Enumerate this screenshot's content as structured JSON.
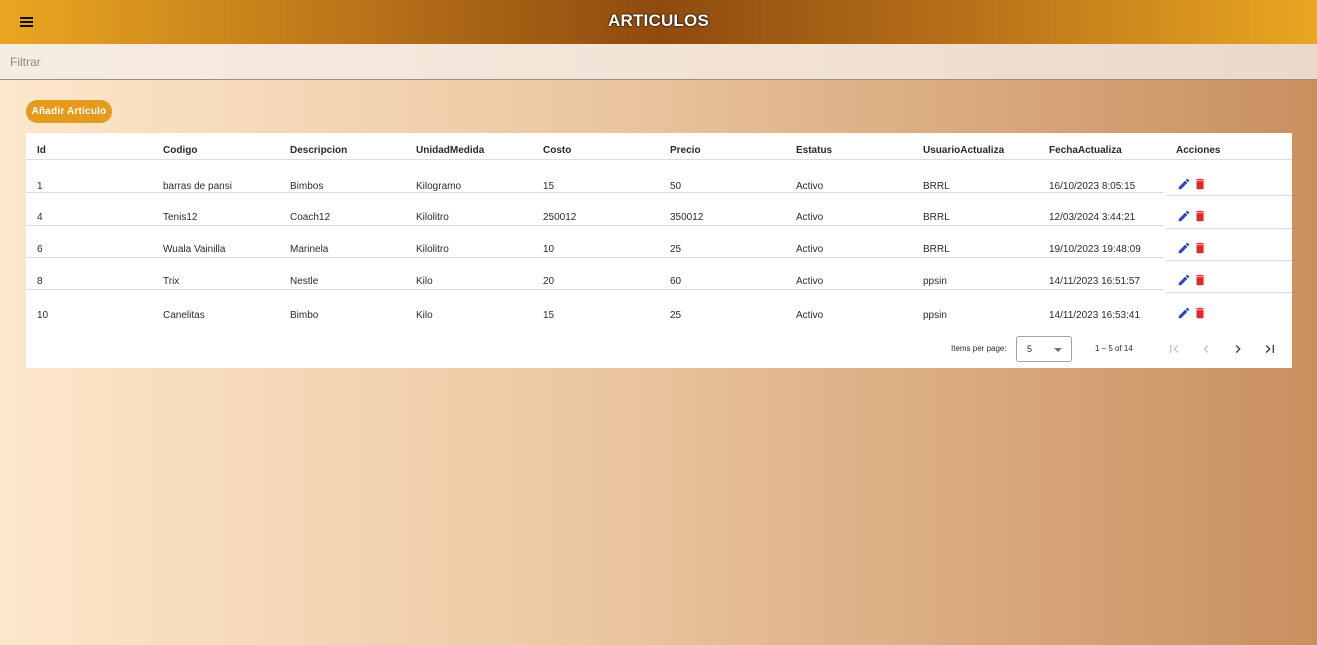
{
  "header": {
    "title": "ARTICULOS",
    "menu_icon": "hamburger-menu-icon",
    "colors": {
      "bar_edge": "#e9a721",
      "bar_center": "#8f4b0f",
      "title_text": "#ffffff"
    }
  },
  "filter": {
    "placeholder": "Filtrar",
    "value": ""
  },
  "actions": {
    "add_label": "Añadir Articulo",
    "add_color": "#e49a1a"
  },
  "table": {
    "columns": [
      "Id",
      "Codigo",
      "Descripcion",
      "UnidadMedida",
      "Costo",
      "Precio",
      "Estatus",
      "UsuarioActualiza",
      "FechaActualiza",
      "Acciones"
    ],
    "rows": [
      {
        "id": "1",
        "codigo": "barras de pansi",
        "descripcion": "Bimbos",
        "unidad": "Kilogramo",
        "costo": "15",
        "precio": "50",
        "estatus": "Activo",
        "usuario": "BRRL",
        "fecha": "16/10/2023 8:05:15"
      },
      {
        "id": "4",
        "codigo": "Tenis12",
        "descripcion": "Coach12",
        "unidad": "Kilolitro",
        "costo": "250012",
        "precio": "350012",
        "estatus": "Activo",
        "usuario": "BRRL",
        "fecha": "12/03/2024 3:44:21"
      },
      {
        "id": "6",
        "codigo": "Wuala Vainilla",
        "descripcion": "Marinela",
        "unidad": "Kilolitro",
        "costo": "10",
        "precio": "25",
        "estatus": "Activo",
        "usuario": "BRRL",
        "fecha": "19/10/2023 19:48:09"
      },
      {
        "id": "8",
        "codigo": "Trix",
        "descripcion": "Nestle",
        "unidad": "Kilo",
        "costo": "20",
        "precio": "60",
        "estatus": "Activo",
        "usuario": "ppsin",
        "fecha": "14/11/2023 16:51:57"
      },
      {
        "id": "10",
        "codigo": "Canelitas",
        "descripcion": "Bimbo",
        "unidad": "Kilo",
        "costo": "15",
        "precio": "25",
        "estatus": "Activo",
        "usuario": "ppsin",
        "fecha": "14/11/2023 16:53:41"
      }
    ],
    "row_action_icons": [
      "edit-pencil-icon",
      "delete-trash-icon"
    ],
    "icon_colors": {
      "edit": "#2b3fd6",
      "delete": "#e5272c"
    }
  },
  "paginator": {
    "items_per_page_label": "Items per page:",
    "items_per_page_value": "5",
    "range_label": "1 – 5 of 14",
    "icons": [
      "first-page-icon",
      "previous-page-icon",
      "next-page-icon",
      "last-page-icon"
    ]
  }
}
